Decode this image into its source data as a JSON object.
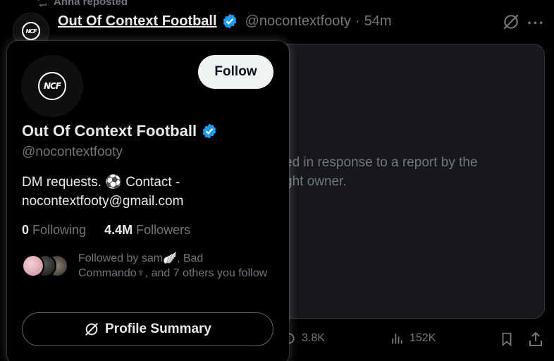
{
  "repost": {
    "text": "Anna reposted"
  },
  "tweet": {
    "logo_text": "NCF",
    "name": "Out Of Context Football",
    "handle": "@nocontextfooty",
    "separator": "·",
    "time": "54m",
    "withheld_text": "ed in response to a report by the\nght owner.",
    "actions": {
      "views_short": "3.8K",
      "views": "152K"
    }
  },
  "card": {
    "logo_text": "NCF",
    "follow_label": "Follow",
    "name": "Out Of Context Football",
    "handle": "@nocontextfooty",
    "bio": "DM requests. ⚽ Contact - nocontextfooty@gmail.com",
    "following_count": "0",
    "following_label": "Following",
    "followers_count": "4.4M",
    "followers_label": "Followers",
    "followed_by_text": "Followed by sam🪽, Bad Commando♆, and 7 others you follow",
    "summary_label": "Profile Summary"
  },
  "colors": {
    "verified": "#1d9bf0",
    "muted": "#71767b",
    "background": "#000000"
  }
}
